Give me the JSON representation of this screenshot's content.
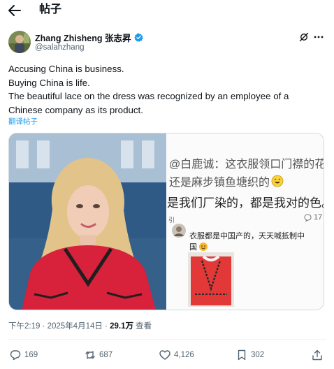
{
  "header": {
    "title": "帖子",
    "back_icon": "arrow-left-icon"
  },
  "author": {
    "name": "Zhang Zhisheng 张志昇",
    "handle": "@salahzhang",
    "verified_color": "#1d9bf0"
  },
  "tweet": {
    "lines": [
      "Accusing China is business.",
      "Buying China is life.",
      "The beautiful lace on the dress was recognized by an employee of a",
      "Chinese company as its product."
    ],
    "translate_label": "翻译帖子"
  },
  "media": {
    "left_image": "press-briefing-photo",
    "right_image": "chinese-social-media-screenshot",
    "right_text": {
      "line1": "@白鹿诚：这衣服领口门襟的花",
      "line2": "还是麻步镇鱼塘织的",
      "line3": "是我们厂染的，都是我对的色。",
      "dot_label": "引",
      "count": "17",
      "line4": "衣服都是中国产的，天天喊抵制中",
      "line5": "国"
    }
  },
  "meta": {
    "time": "下午2:19 · 2025年4月14日 · ",
    "views": "29.1万",
    "views_label": " 查看"
  },
  "actions": {
    "replies": "169",
    "reposts": "687",
    "likes": "4,126",
    "bookmarks": "302"
  },
  "colors": {
    "accent": "#1d9bf0",
    "muted": "#536471",
    "text": "#0f1419"
  }
}
